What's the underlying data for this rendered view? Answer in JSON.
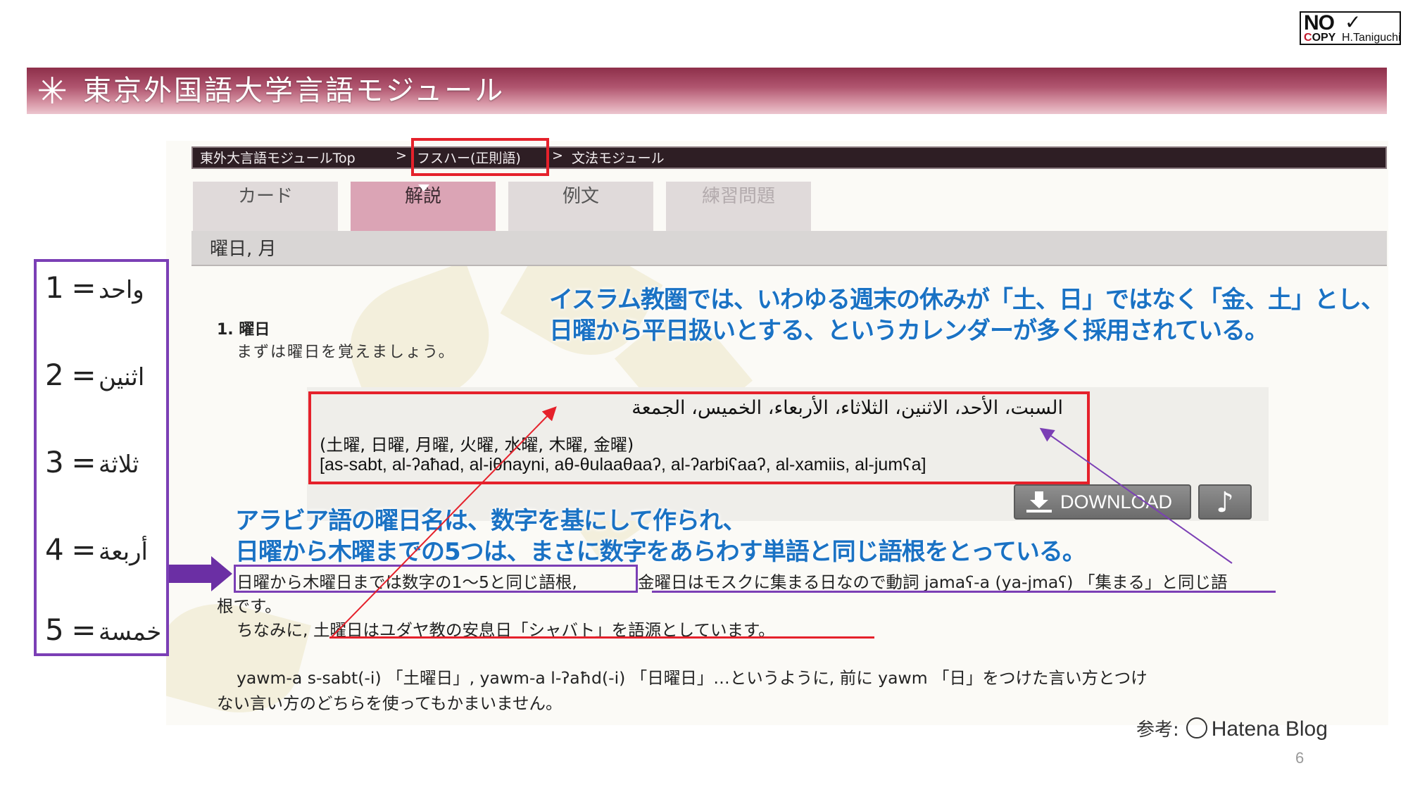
{
  "logo": {
    "line1": "NO",
    "copy_c": "C",
    "copy_rest": "OPY",
    "author": "H.Taniguchi",
    "tick": "✓"
  },
  "banner": {
    "star": "✳",
    "title": "東京外国語大学言語モジュール"
  },
  "breadcrumb": {
    "items": [
      "東外大言語モジュールTop",
      ">",
      "フスハー(正則語)",
      ">",
      "文法モジュール"
    ]
  },
  "tabs": [
    {
      "label": "カード",
      "state": "normal"
    },
    {
      "label": "解説",
      "state": "active"
    },
    {
      "label": "例文",
      "state": "normal"
    },
    {
      "label": "練習問題",
      "state": "disabled"
    }
  ],
  "subheader": "曜日, 月",
  "section": {
    "title": "1. 曜日",
    "intro": "まずは曜日を覚えましょう。"
  },
  "days": {
    "arabic": "السبت، الأحد، الاثنين، الثلاثاء، الأربعاء، الخميس، الجمعة",
    "japanese": "(土曜, 日曜, 月曜, 火曜, 水曜, 木曜, 金曜)",
    "transliteration": "[as-sabt, al-ʔaħad, al-iθnayni, aθ-θulaaθaaʔ, al-ʔarbiʕaaʔ, al-xamiis, al-jumʕa]"
  },
  "buttons": {
    "download": "DOWNLOAD",
    "audio": "♪"
  },
  "body": {
    "p1_a": "日曜から木曜日までは数字の1～5と同じ語根,",
    "p1_b": " 金曜日はモスクに集まる日なので動詞 jamaʕ-a (ya-jmaʕ) 「集まる」と同じ語",
    "p1_c": "根です。",
    "p2": "ちなみに, 土曜日はユダヤ教の安息日「シャバト」を語源としています。",
    "p3_a": "yawm-a s-sabt(-i) 「土曜日」, yawm-a l-ʔaħd(-i) 「日曜日」…というように, 前に yawm 「日」をつけた言い方とつけ",
    "p3_b": "ない言い方のどちらを使ってもかまいません。"
  },
  "notes": {
    "islam_1": "イスラム教圏では、いわゆる週末の休みが「土、日」ではなく「金、土」とし、",
    "islam_2": "日曜から平日扱いとする、というカレンダーが多く採用されている。",
    "arabic_1": "アラビア語の曜日名は、数字を基にして作られ、",
    "arabic_2": "日曜から木曜までの5つは、まさに数字をあらわす単語と同じ語根をとっている。"
  },
  "numbers": [
    {
      "num": "1",
      "eq": "=",
      "word": "واحد"
    },
    {
      "num": "2",
      "eq": "=",
      "word": "اثنين"
    },
    {
      "num": "3",
      "eq": "=",
      "word": "ثلاثة"
    },
    {
      "num": "4",
      "eq": "=",
      "word": "أربعة"
    },
    {
      "num": "5",
      "eq": "=",
      "word": "خمسة"
    }
  ],
  "reference": {
    "label": "参考:",
    "source": "Hatena Blog"
  },
  "page_number": "6",
  "colors": {
    "banner": "#8e2f4a",
    "active_tab": "#dba4b5",
    "note_blue": "#1a72c4",
    "annotation_red": "#e5212b",
    "annotation_purple": "#7b3fb5"
  }
}
